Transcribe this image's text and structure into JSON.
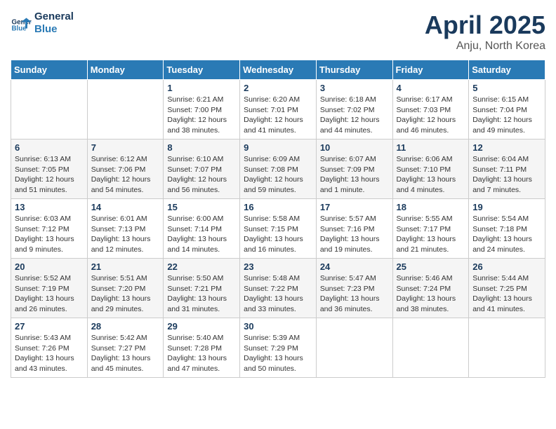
{
  "logo": {
    "line1": "General",
    "line2": "Blue"
  },
  "title": "April 2025",
  "subtitle": "Anju, North Korea",
  "weekdays": [
    "Sunday",
    "Monday",
    "Tuesday",
    "Wednesday",
    "Thursday",
    "Friday",
    "Saturday"
  ],
  "weeks": [
    [
      {
        "day": "",
        "info": ""
      },
      {
        "day": "",
        "info": ""
      },
      {
        "day": "1",
        "info": "Sunrise: 6:21 AM\nSunset: 7:00 PM\nDaylight: 12 hours\nand 38 minutes."
      },
      {
        "day": "2",
        "info": "Sunrise: 6:20 AM\nSunset: 7:01 PM\nDaylight: 12 hours\nand 41 minutes."
      },
      {
        "day": "3",
        "info": "Sunrise: 6:18 AM\nSunset: 7:02 PM\nDaylight: 12 hours\nand 44 minutes."
      },
      {
        "day": "4",
        "info": "Sunrise: 6:17 AM\nSunset: 7:03 PM\nDaylight: 12 hours\nand 46 minutes."
      },
      {
        "day": "5",
        "info": "Sunrise: 6:15 AM\nSunset: 7:04 PM\nDaylight: 12 hours\nand 49 minutes."
      }
    ],
    [
      {
        "day": "6",
        "info": "Sunrise: 6:13 AM\nSunset: 7:05 PM\nDaylight: 12 hours\nand 51 minutes."
      },
      {
        "day": "7",
        "info": "Sunrise: 6:12 AM\nSunset: 7:06 PM\nDaylight: 12 hours\nand 54 minutes."
      },
      {
        "day": "8",
        "info": "Sunrise: 6:10 AM\nSunset: 7:07 PM\nDaylight: 12 hours\nand 56 minutes."
      },
      {
        "day": "9",
        "info": "Sunrise: 6:09 AM\nSunset: 7:08 PM\nDaylight: 12 hours\nand 59 minutes."
      },
      {
        "day": "10",
        "info": "Sunrise: 6:07 AM\nSunset: 7:09 PM\nDaylight: 13 hours\nand 1 minute."
      },
      {
        "day": "11",
        "info": "Sunrise: 6:06 AM\nSunset: 7:10 PM\nDaylight: 13 hours\nand 4 minutes."
      },
      {
        "day": "12",
        "info": "Sunrise: 6:04 AM\nSunset: 7:11 PM\nDaylight: 13 hours\nand 7 minutes."
      }
    ],
    [
      {
        "day": "13",
        "info": "Sunrise: 6:03 AM\nSunset: 7:12 PM\nDaylight: 13 hours\nand 9 minutes."
      },
      {
        "day": "14",
        "info": "Sunrise: 6:01 AM\nSunset: 7:13 PM\nDaylight: 13 hours\nand 12 minutes."
      },
      {
        "day": "15",
        "info": "Sunrise: 6:00 AM\nSunset: 7:14 PM\nDaylight: 13 hours\nand 14 minutes."
      },
      {
        "day": "16",
        "info": "Sunrise: 5:58 AM\nSunset: 7:15 PM\nDaylight: 13 hours\nand 16 minutes."
      },
      {
        "day": "17",
        "info": "Sunrise: 5:57 AM\nSunset: 7:16 PM\nDaylight: 13 hours\nand 19 minutes."
      },
      {
        "day": "18",
        "info": "Sunrise: 5:55 AM\nSunset: 7:17 PM\nDaylight: 13 hours\nand 21 minutes."
      },
      {
        "day": "19",
        "info": "Sunrise: 5:54 AM\nSunset: 7:18 PM\nDaylight: 13 hours\nand 24 minutes."
      }
    ],
    [
      {
        "day": "20",
        "info": "Sunrise: 5:52 AM\nSunset: 7:19 PM\nDaylight: 13 hours\nand 26 minutes."
      },
      {
        "day": "21",
        "info": "Sunrise: 5:51 AM\nSunset: 7:20 PM\nDaylight: 13 hours\nand 29 minutes."
      },
      {
        "day": "22",
        "info": "Sunrise: 5:50 AM\nSunset: 7:21 PM\nDaylight: 13 hours\nand 31 minutes."
      },
      {
        "day": "23",
        "info": "Sunrise: 5:48 AM\nSunset: 7:22 PM\nDaylight: 13 hours\nand 33 minutes."
      },
      {
        "day": "24",
        "info": "Sunrise: 5:47 AM\nSunset: 7:23 PM\nDaylight: 13 hours\nand 36 minutes."
      },
      {
        "day": "25",
        "info": "Sunrise: 5:46 AM\nSunset: 7:24 PM\nDaylight: 13 hours\nand 38 minutes."
      },
      {
        "day": "26",
        "info": "Sunrise: 5:44 AM\nSunset: 7:25 PM\nDaylight: 13 hours\nand 41 minutes."
      }
    ],
    [
      {
        "day": "27",
        "info": "Sunrise: 5:43 AM\nSunset: 7:26 PM\nDaylight: 13 hours\nand 43 minutes."
      },
      {
        "day": "28",
        "info": "Sunrise: 5:42 AM\nSunset: 7:27 PM\nDaylight: 13 hours\nand 45 minutes."
      },
      {
        "day": "29",
        "info": "Sunrise: 5:40 AM\nSunset: 7:28 PM\nDaylight: 13 hours\nand 47 minutes."
      },
      {
        "day": "30",
        "info": "Sunrise: 5:39 AM\nSunset: 7:29 PM\nDaylight: 13 hours\nand 50 minutes."
      },
      {
        "day": "",
        "info": ""
      },
      {
        "day": "",
        "info": ""
      },
      {
        "day": "",
        "info": ""
      }
    ]
  ]
}
